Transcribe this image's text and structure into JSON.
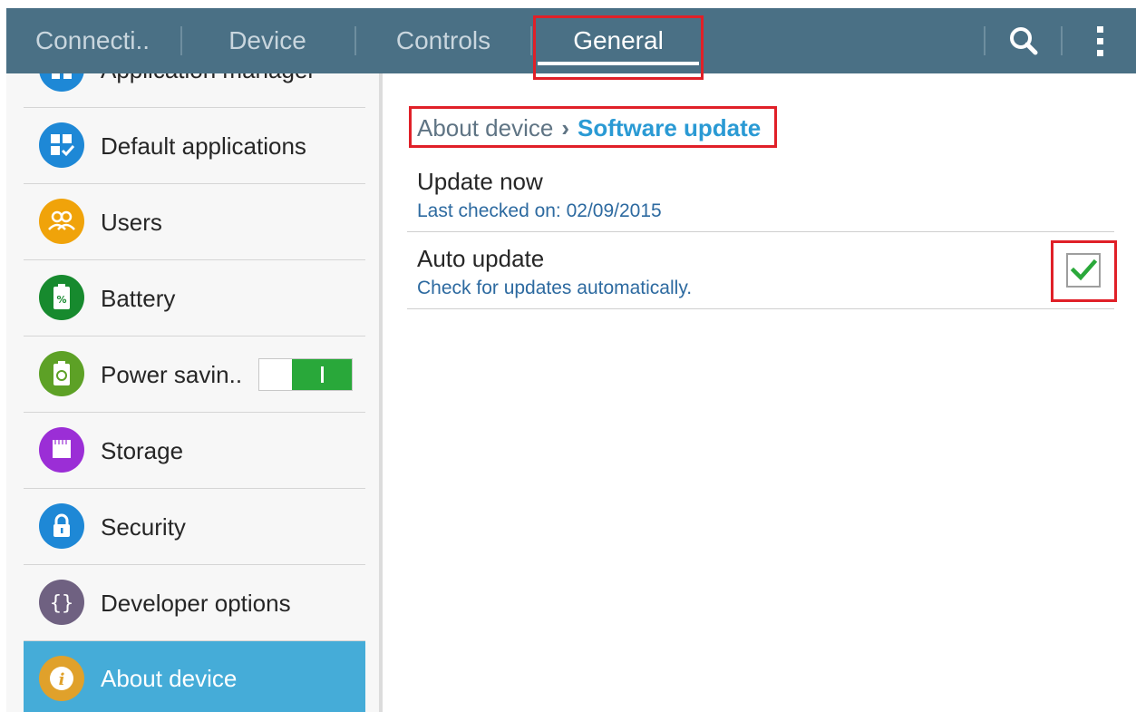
{
  "tabs": [
    {
      "label": "Connecti.."
    },
    {
      "label": "Device"
    },
    {
      "label": "Controls"
    },
    {
      "label": "General"
    }
  ],
  "toolbar": {
    "search_icon": "search-icon",
    "menu_icon": "more-vert-icon"
  },
  "sidebar": {
    "items": [
      {
        "label": "Application manager",
        "icon": "application-manager-icon",
        "color": "#1e88d6"
      },
      {
        "label": "Default applications",
        "icon": "default-applications-icon",
        "color": "#1e88d6"
      },
      {
        "label": "Users",
        "icon": "users-icon",
        "color": "#f0a30a"
      },
      {
        "label": "Battery",
        "icon": "battery-icon",
        "color": "#178a2e"
      },
      {
        "label": "Power savin..",
        "icon": "power-saving-icon",
        "color": "#5da126",
        "toggle_on": true
      },
      {
        "label": "Storage",
        "icon": "storage-icon",
        "color": "#9b2ed6"
      },
      {
        "label": "Security",
        "icon": "lock-icon",
        "color": "#1e88d6"
      },
      {
        "label": "Developer options",
        "icon": "developer-options-icon",
        "color": "#6f6181"
      },
      {
        "label": "About device",
        "icon": "info-icon",
        "color": "#e0a12b",
        "selected": true
      }
    ]
  },
  "breadcrumb": {
    "parent": "About device",
    "current": "Software update"
  },
  "settings": {
    "update_now": {
      "title": "Update now",
      "subtitle": "Last checked on: 02/09/2015"
    },
    "auto_update": {
      "title": "Auto update",
      "subtitle": "Check for updates automatically.",
      "checked": true
    }
  },
  "colors": {
    "tabbar": "#4a7085",
    "accent": "#45acd8",
    "highlight": "#e02028",
    "check": "#2aa83a"
  }
}
